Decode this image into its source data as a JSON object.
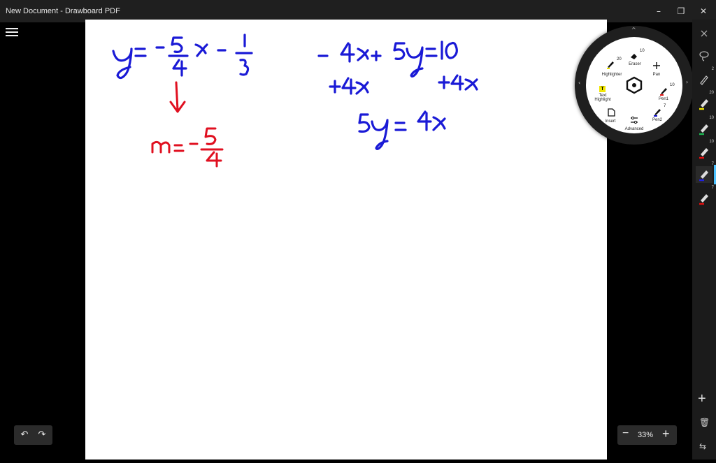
{
  "window": {
    "title": "New Document - Drawboard PDF",
    "minimize": "–",
    "restore": "❐",
    "close": "✕"
  },
  "history": {
    "undo": "↶",
    "redo": "↷"
  },
  "zoom": {
    "minus": "−",
    "level": "33%",
    "plus": "+"
  },
  "radial_menu": {
    "items": [
      {
        "label": "Eraser",
        "value": "10"
      },
      {
        "label": "Highlighter",
        "value": "20"
      },
      {
        "label": "Pan"
      },
      {
        "label": "Text Highlight",
        "line1": "Text",
        "line2": "Highlight"
      },
      {
        "label": "Pen1",
        "value": "10"
      },
      {
        "label": "Insert"
      },
      {
        "label": "Pen2",
        "value": "7"
      },
      {
        "label": "Advanced"
      }
    ],
    "colors": {
      "highlighter": "#f2e600",
      "pen1": "#e01010",
      "pen2": "#1010c8"
    }
  },
  "toolbar": {
    "items": [
      {
        "name": "pan",
        "icon": "pan-icon"
      },
      {
        "name": "lasso",
        "icon": "lasso-icon"
      },
      {
        "name": "pen-small",
        "value": "2",
        "color": "#cccccc"
      },
      {
        "name": "highlighter",
        "value": "20",
        "color": "#f2e600"
      },
      {
        "name": "pen-green",
        "value": "10",
        "color": "#1db954"
      },
      {
        "name": "pen-red",
        "value": "10",
        "color": "#e01010"
      },
      {
        "name": "pen-blue",
        "value": "7",
        "color": "#2020e0"
      },
      {
        "name": "pen-red2",
        "value": "7",
        "color": "#e01010"
      }
    ],
    "add": "+",
    "delete": "🗑",
    "swap": "⇆"
  },
  "handwriting": {
    "equation1": "y = -5/4 x - 1/3",
    "slope": "m = -5/4",
    "equation2": "-4x + 5y = 10",
    "step": "+4x    +4x",
    "result": "5y = 4x",
    "colors": {
      "blue": "#1a1ad6",
      "red": "#e01020"
    }
  }
}
